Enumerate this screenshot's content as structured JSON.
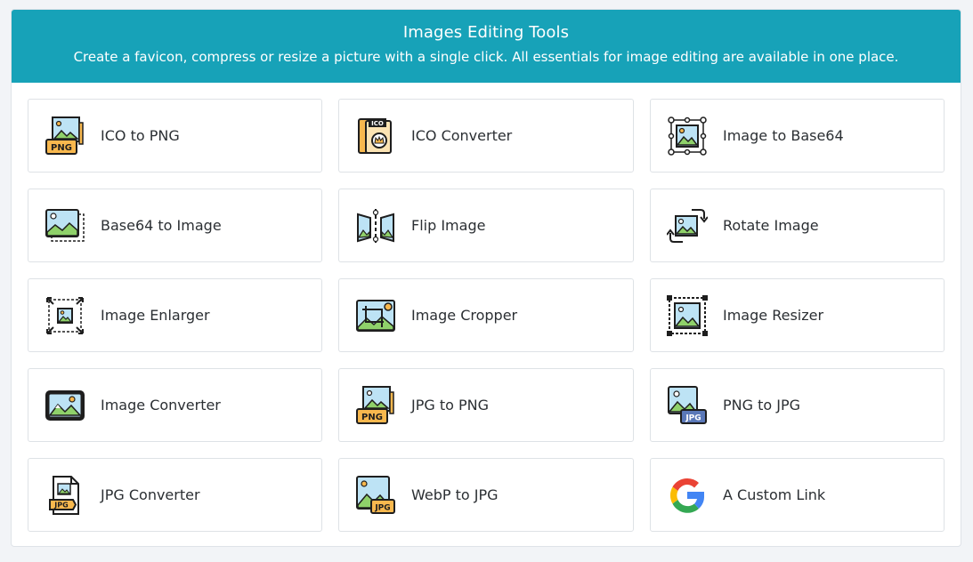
{
  "header": {
    "title": "Images Editing Tools",
    "subtitle": "Create a favicon, compress or resize a picture with a single click. All essentials for image editing are available in one place."
  },
  "colors": {
    "header_bg": "#17a2b8",
    "icon_green": "#8fd16a",
    "icon_blue": "#bde3f5",
    "icon_orange": "#f8b84e",
    "outline": "#1e1e1e"
  },
  "tools": [
    {
      "label": "ICO to PNG",
      "icon": "ico-to-png-icon"
    },
    {
      "label": "ICO Converter",
      "icon": "ico-converter-icon"
    },
    {
      "label": "Image to Base64",
      "icon": "image-to-base64-icon"
    },
    {
      "label": "Base64 to Image",
      "icon": "base64-to-image-icon"
    },
    {
      "label": "Flip Image",
      "icon": "flip-image-icon"
    },
    {
      "label": "Rotate Image",
      "icon": "rotate-image-icon"
    },
    {
      "label": "Image Enlarger",
      "icon": "image-enlarger-icon"
    },
    {
      "label": "Image Cropper",
      "icon": "image-cropper-icon"
    },
    {
      "label": "Image Resizer",
      "icon": "image-resizer-icon"
    },
    {
      "label": "Image Converter",
      "icon": "image-converter-icon"
    },
    {
      "label": "JPG to PNG",
      "icon": "jpg-to-png-icon"
    },
    {
      "label": "PNG to JPG",
      "icon": "png-to-jpg-icon"
    },
    {
      "label": "JPG Converter",
      "icon": "jpg-converter-icon"
    },
    {
      "label": "WebP to JPG",
      "icon": "webp-to-jpg-icon"
    },
    {
      "label": "A Custom Link",
      "icon": "google-icon"
    }
  ],
  "badges": {
    "png": "PNG",
    "ico": "ICO",
    "jpg": "JPG"
  }
}
